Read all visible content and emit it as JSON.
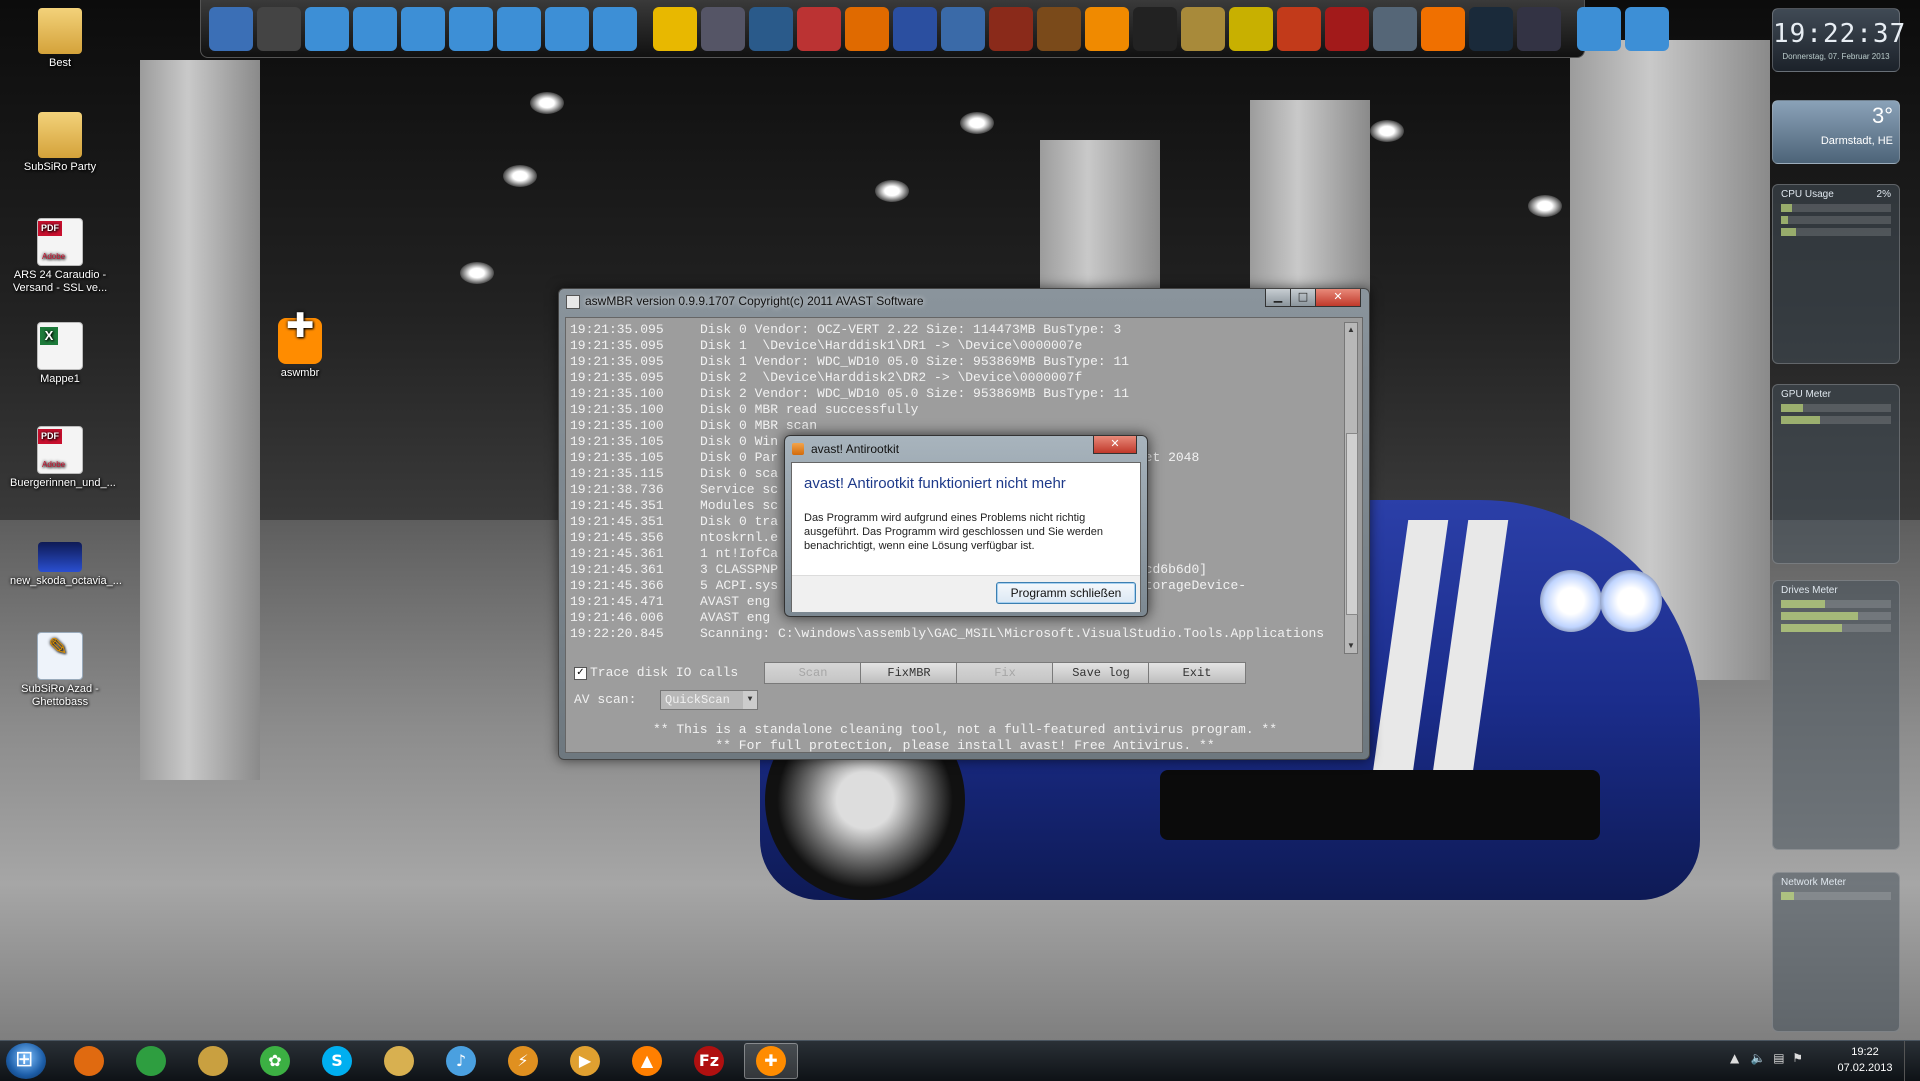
{
  "desktop": {
    "icons": [
      {
        "label": "Best",
        "glyph": "folder-icon"
      },
      {
        "label": "SubSiRo Party",
        "glyph": "folder-icon"
      },
      {
        "label": "ARS 24 Caraudio - Versand - SSL ve...",
        "glyph": "pdf-icon"
      },
      {
        "label": "Mappe1",
        "glyph": "excel-icon"
      },
      {
        "label": "Buergerinnen_und_...",
        "glyph": "pdf-icon"
      },
      {
        "label": "new_skoda_octavia_...",
        "glyph": "image-icon"
      },
      {
        "label": "SubSiRo Azad - Ghettobass",
        "glyph": "script-icon"
      },
      {
        "label": "aswmbr",
        "glyph": "aswmbr-icon"
      }
    ]
  },
  "dock": {
    "icons": [
      "explorer-icon",
      "user-icon",
      "folder-icon",
      "folder-icon",
      "folder-icon",
      "folder-icon",
      "video-folder-icon",
      "music-folder-icon",
      "settings-folder-icon",
      "game-3-icon",
      "battlefield-icon",
      "halo-icon",
      "crysis-icon",
      "bf3-icon",
      "warcraft-icon",
      "starcraft-icon",
      "diablo-icon",
      "borderlands-icon",
      "anno-icon",
      "two-icon",
      "mw3-icon",
      "nuclear-icon",
      "generic-game-icon",
      "metro-icon",
      "counterstrike-icon",
      "origin-icon",
      "steam-icon",
      "teamspeak-icon",
      "computer-icon",
      "recycle-bin-icon"
    ]
  },
  "gadgets": {
    "clock_time": "19:22:37",
    "clock_date": "Donnerstag, 07. Februar 2013",
    "weather_temp": "3°",
    "weather_location": "Darmstadt, HE",
    "cpu_title": "CPU Usage",
    "cpu_value": "2%",
    "gpu_title": "GPU Meter",
    "drives_title": "Drives Meter",
    "network_title": "Network Meter"
  },
  "window": {
    "title": "aswMBR version 0.9.9.1707 Copyright(c) 2011 AVAST Software",
    "log": [
      {
        "ts": "19:21:35.095",
        "msg": "Disk 0 Vendor: OCZ-VERT 2.22 Size: 114473MB BusType: 3"
      },
      {
        "ts": "19:21:35.095",
        "msg": "Disk 1  \\Device\\Harddisk1\\DR1 -> \\Device\\0000007e"
      },
      {
        "ts": "19:21:35.095",
        "msg": "Disk 1 Vendor: WDC_WD10 05.0 Size: 953869MB BusType: 11"
      },
      {
        "ts": "19:21:35.095",
        "msg": "Disk 2  \\Device\\Harddisk2\\DR2 -> \\Device\\0000007f"
      },
      {
        "ts": "19:21:35.100",
        "msg": "Disk 2 Vendor: WDC_WD10 05.0 Size: 953869MB BusType: 11"
      },
      {
        "ts": "19:21:35.100",
        "msg": "Disk 0 MBR read successfully"
      },
      {
        "ts": "19:21:35.100",
        "msg": "Disk 0 MBR scan"
      },
      {
        "ts": "19:21:35.105",
        "msg": "Disk 0 Win"
      },
      {
        "ts": "19:21:35.105",
        "msg": "Disk 0 Par                                    471 MB offset 2048"
      },
      {
        "ts": "19:21:35.115",
        "msg": "Disk 0 sca"
      },
      {
        "ts": "19:21:38.736",
        "msg": "Service sc"
      },
      {
        "ts": "19:21:45.351",
        "msg": "Modules sc"
      },
      {
        "ts": "19:21:45.351",
        "msg": "Disk 0 tra"
      },
      {
        "ts": "19:21:45.356",
        "msg": "ntoskrnl.e                                    al.dll"
      },
      {
        "ts": "19:21:45.361",
        "msg": "1 nt!IofCa                                   09a790]"
      },
      {
        "ts": "19:21:45.361",
        "msg": "3 CLASSPNP                                   [0xfffffa800cd6b6d0]"
      },
      {
        "ts": "19:21:45.366",
        "msg": "5 ACPI.sys                                   ice\\Ide\\IAAStorageDevice-"
      },
      {
        "ts": "19:21:45.471",
        "msg": "AVAST eng"
      },
      {
        "ts": "19:21:46.006",
        "msg": "AVAST eng"
      },
      {
        "ts": "19:22:20.845",
        "msg": "Scanning: C:\\windows\\assembly\\GAC_MSIL\\Microsoft.VisualStudio.Tools.Applications"
      }
    ],
    "trace_label": "Trace disk IO calls",
    "buttons": {
      "scan": "Scan",
      "fixmbr": "FixMBR",
      "fix": "Fix",
      "save_log": "Save log",
      "exit": "Exit"
    },
    "av_scan_label": "AV scan:",
    "av_scan_value": "QuickScan",
    "notice1": "** This is a standalone cleaning tool, not a full-featured antivirus program. **",
    "notice2": "** For full protection, please install avast! Free Antivirus. **"
  },
  "dialog": {
    "title": "avast! Antirootkit",
    "heading": "avast! Antirootkit funktioniert nicht mehr",
    "text": "Das Programm wird aufgrund eines Problems nicht richtig ausgeführt. Das Programm wird geschlossen und Sie werden benachrichtigt, wenn eine Lösung verfügbar ist.",
    "button": "Programm schließen"
  },
  "taskbar": {
    "items": [
      "firefox-icon",
      "chrome-icon",
      "explorer-icon",
      "icq-icon",
      "skype-icon",
      "folder-icon",
      "itunes-icon",
      "winamp-icon",
      "media-player-icon",
      "vlc-icon",
      "filezilla-icon",
      "aswmbr-icon"
    ],
    "time": "19:22",
    "date": "07.02.2013"
  }
}
